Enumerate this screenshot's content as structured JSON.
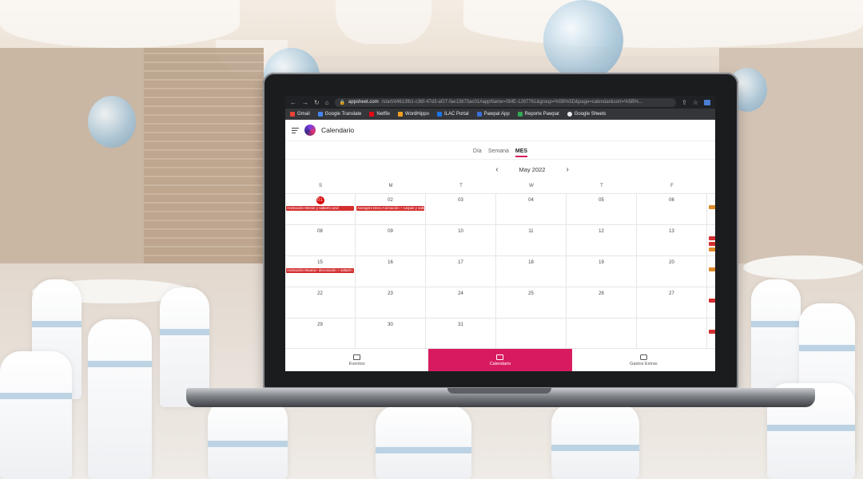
{
  "browser": {
    "url_host": "appsheet.com",
    "url_path": "/start/d4613fb1-c36f-47d3-af27-fae13873ac01#appName=SME-1267761&group=%5B%5D&page=calendar&sort=%5B%...",
    "bookmarks": [
      {
        "label": "Gmail",
        "color": "#ea4335"
      },
      {
        "label": "Google Translate",
        "color": "#4285f4"
      },
      {
        "label": "Netflix",
        "color": "#e50914"
      },
      {
        "label": "WordHippo",
        "color": "#f4a020"
      },
      {
        "label": "ILAC Portal",
        "color": "#1a73e8"
      },
      {
        "label": "Pawpat App",
        "color": "#3b6fd8"
      },
      {
        "label": "Reporte Pawpat",
        "color": "#34a853"
      },
      {
        "label": "Google Sheets",
        "color": "#e8eaed"
      }
    ]
  },
  "app": {
    "title": "Calendario",
    "view_tabs": [
      "Día",
      "Semana",
      "MES"
    ],
    "active_view": "MES",
    "month_label": "May 2022",
    "weekdays": [
      "S",
      "M",
      "T",
      "W",
      "T",
      "F"
    ],
    "weeks": [
      [
        "01",
        "02",
        "03",
        "04",
        "05",
        "06"
      ],
      [
        "08",
        "09",
        "10",
        "11",
        "12",
        "13"
      ],
      [
        "15",
        "16",
        "17",
        "18",
        "19",
        "20"
      ],
      [
        "22",
        "23",
        "24",
        "25",
        "26",
        "27"
      ],
      [
        "29",
        "30",
        "31",
        "",
        "",
        ""
      ]
    ],
    "events": {
      "e1": "Animación Minnie y saltarín azul",
      "e2": "Avengers Deco Animación + carpas y saltarín",
      "e3": "Animación Moana+ decoración + saltarín"
    },
    "bottom_nav": [
      "Eventos",
      "Calendario",
      "Gastos Extras"
    ],
    "accent_color": "#d81b60",
    "event_color": "#d32f2f"
  }
}
